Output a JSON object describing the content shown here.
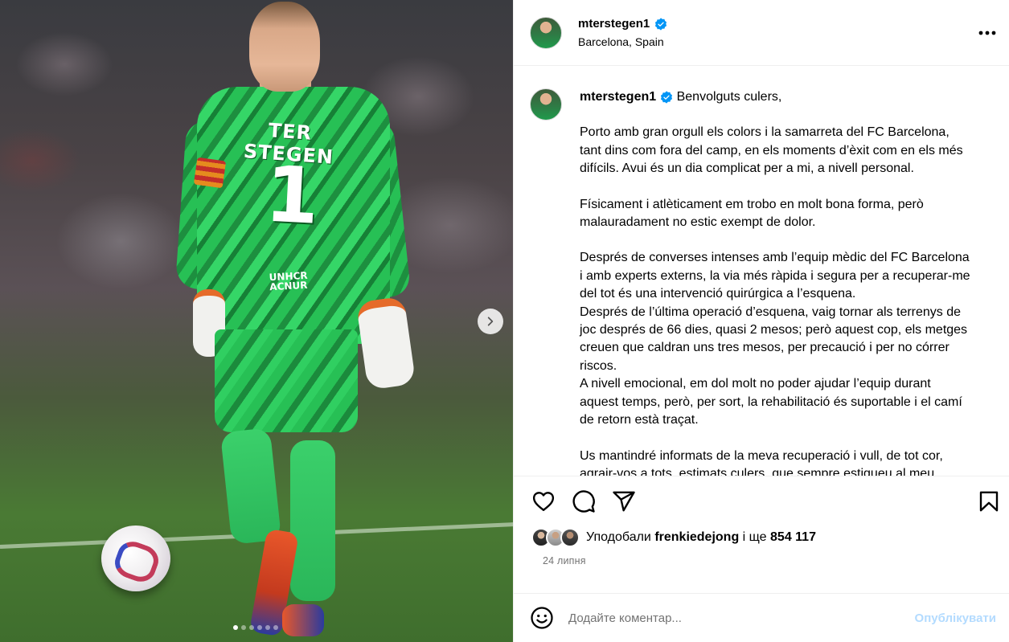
{
  "author": {
    "username": "mterstegen1",
    "location": "Barcelona, Spain",
    "verified": true
  },
  "media": {
    "jersey_name": "TER STEGEN",
    "jersey_number": "1",
    "sponsor_line1": "UNHCR",
    "sponsor_line2": "ACNUR",
    "slide_count": 6,
    "active_slide": 1
  },
  "caption": {
    "greeting": "Benvolguts culers,",
    "paragraphs": [
      [
        "Porto amb gran orgull els colors i la samarreta del FC Barcelona,",
        "tant dins com fora del camp, en els moments d’èxit com en els més",
        "difícils. Avui és un dia complicat per a mi, a nivell personal."
      ],
      [
        "Físicament i atlèticament em trobo en molt bona forma, però",
        "malauradament no estic exempt de dolor."
      ],
      [
        "Després de converses intenses amb l’equip mèdic del FC Barcelona",
        "i amb experts externs, la via més ràpida i segura per a recuperar-me",
        "del tot és una intervenció quirúrgica a l’esquena.",
        "Després de l’última operació d’esquena, vaig tornar als terrenys de",
        "joc després de 66 dies, quasi 2 mesos; però aquest cop, els metges",
        "creuen que caldran uns tres mesos, per precaució i per no córrer",
        "riscos.",
        "A nivell emocional, em dol molt no poder ajudar l’equip durant",
        "aquest temps, però, per sort, la rehabilitació és suportable i el camí",
        "de retorn està traçat."
      ],
      [
        "Us mantindré informats de la meva recuperació i vull, de tot cor,",
        "agrair-vos a tots, estimats culers, que sempre estigueu al meu"
      ]
    ]
  },
  "likes": {
    "prefix": "Уподобали",
    "user": "frenkiedejong",
    "middle": "і ще",
    "count": "854 117"
  },
  "date": "24 липня",
  "comment_box": {
    "placeholder": "Додайте коментар...",
    "submit_label": "Опублікувати"
  },
  "colors": {
    "verified_badge": "#0095f6",
    "post_button_disabled": "#b3dbff",
    "secondary_text": "#737373"
  },
  "icons": [
    "verified-badge-icon",
    "more-options-icon",
    "heart-icon",
    "comment-icon",
    "share-icon",
    "bookmark-icon",
    "emoji-icon",
    "chevron-right-icon"
  ]
}
